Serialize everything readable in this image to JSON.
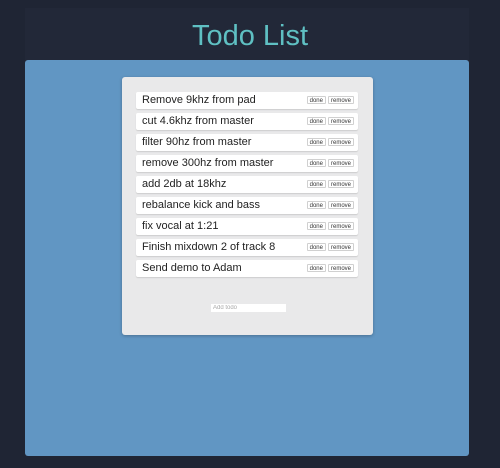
{
  "app": {
    "title": "Todo List"
  },
  "todos": [
    {
      "text": "Remove 9khz from pad",
      "done_label": "done",
      "remove_label": "remove"
    },
    {
      "text": "cut 4.6khz from master",
      "done_label": "done",
      "remove_label": "remove"
    },
    {
      "text": "filter 90hz from master",
      "done_label": "done",
      "remove_label": "remove"
    },
    {
      "text": "remove 300hz from master",
      "done_label": "done",
      "remove_label": "remove"
    },
    {
      "text": "add 2db at 18khz",
      "done_label": "done",
      "remove_label": "remove"
    },
    {
      "text": "rebalance kick and bass",
      "done_label": "done",
      "remove_label": "remove"
    },
    {
      "text": "fix vocal at 1:21",
      "done_label": "done",
      "remove_label": "remove"
    },
    {
      "text": "Finish mixdown 2 of track 8",
      "done_label": "done",
      "remove_label": "remove"
    },
    {
      "text": "Send demo to Adam",
      "done_label": "done",
      "remove_label": "remove"
    }
  ],
  "add_todo": {
    "placeholder": "Add todo",
    "value": ""
  },
  "colors": {
    "background": "#1f2534",
    "title": "#5fc0c3",
    "panel": "#6196c3",
    "card": "#e9e9ea"
  }
}
